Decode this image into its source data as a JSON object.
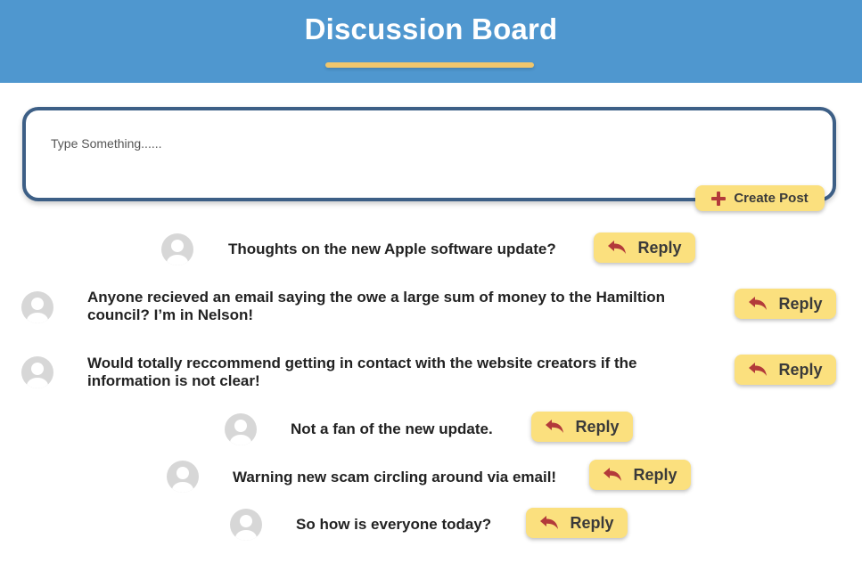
{
  "header": {
    "title": "Discussion Board"
  },
  "composer": {
    "placeholder": "Type Something......",
    "create_label": "Create Post"
  },
  "posts": [
    {
      "text": "Thoughts on the new Apple software update?",
      "reply_label": "Reply"
    },
    {
      "text": "Anyone recieved an email saying the owe a large sum of money to the Hamiltion council? I’m in Nelson!",
      "reply_label": "Reply"
    },
    {
      "text": "Would totally reccommend getting in contact with the website creators if the information is not clear!",
      "reply_label": "Reply"
    },
    {
      "text": "Not a fan of the new update.",
      "reply_label": "Reply"
    },
    {
      "text": "Warning new scam circling around via email!",
      "reply_label": "Reply"
    },
    {
      "text": "So how is everyone today?",
      "reply_label": "Reply"
    }
  ],
  "colors": {
    "header_bg": "#4f97cf",
    "accent_underline": "#f0c66c",
    "button_bg": "#fbe07e",
    "icon_red": "#b33a3a",
    "composer_border": "#3d5f86",
    "avatar_bg": "#d7d7d7"
  },
  "icons": {
    "create": "plus-icon",
    "reply": "reply-arrow-icon",
    "avatar": "user-avatar-icon"
  }
}
